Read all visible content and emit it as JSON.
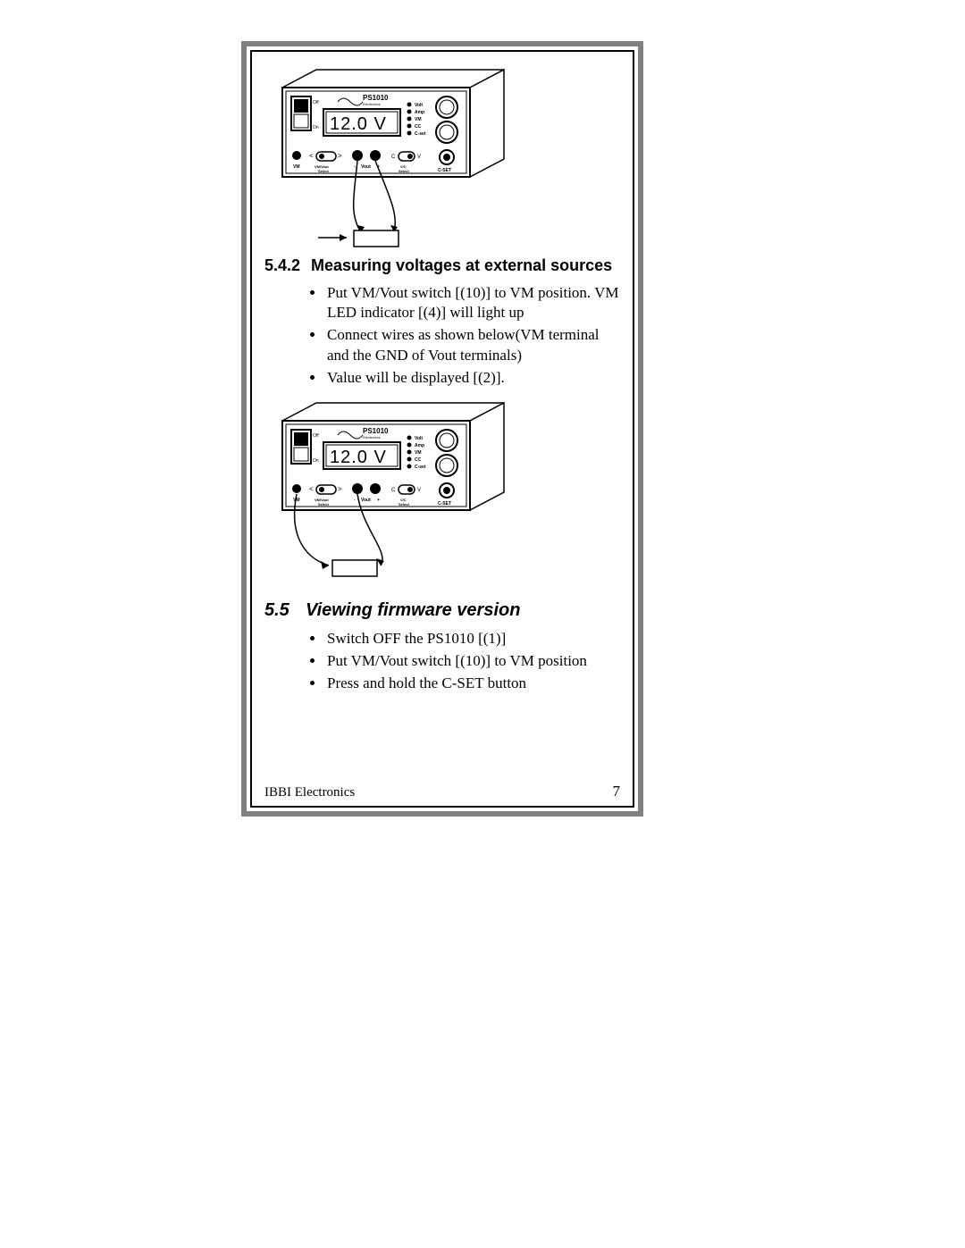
{
  "section1": {
    "number": "5.4.2",
    "title": "Measuring voltages at external sources",
    "bullets": [
      "Put VM/Vout switch [(10)] to VM position. VM LED indicator [(4)] will light up",
      "Connect wires as shown below(VM terminal and the GND of  Vout terminals)",
      "Value will be displayed [(2)]."
    ]
  },
  "section2": {
    "number": "5.5",
    "title": "Viewing firmware version",
    "bullets": [
      "Switch OFF the PS1010 [(1)]",
      "Put VM/Vout switch [(10)] to VM position",
      "Press and hold the C-SET button"
    ]
  },
  "device": {
    "model": "PS1010",
    "brand_sub": "Electronics",
    "display": "12.0 V",
    "switch_off": "Off",
    "switch_on": "On",
    "leds": [
      "Volt",
      "Amp",
      "VM",
      "CC",
      "C-set"
    ],
    "labels": {
      "vm": "VM",
      "vmvout_select": "VM/Vout Select",
      "vout_minus": "-",
      "vout": "Vout",
      "vout_plus": "+",
      "vc_select": "V/C Select",
      "cset": "C-SET",
      "c": "C",
      "v": "V"
    }
  },
  "footer": {
    "left": "IBBI Electronics",
    "page": "7"
  }
}
